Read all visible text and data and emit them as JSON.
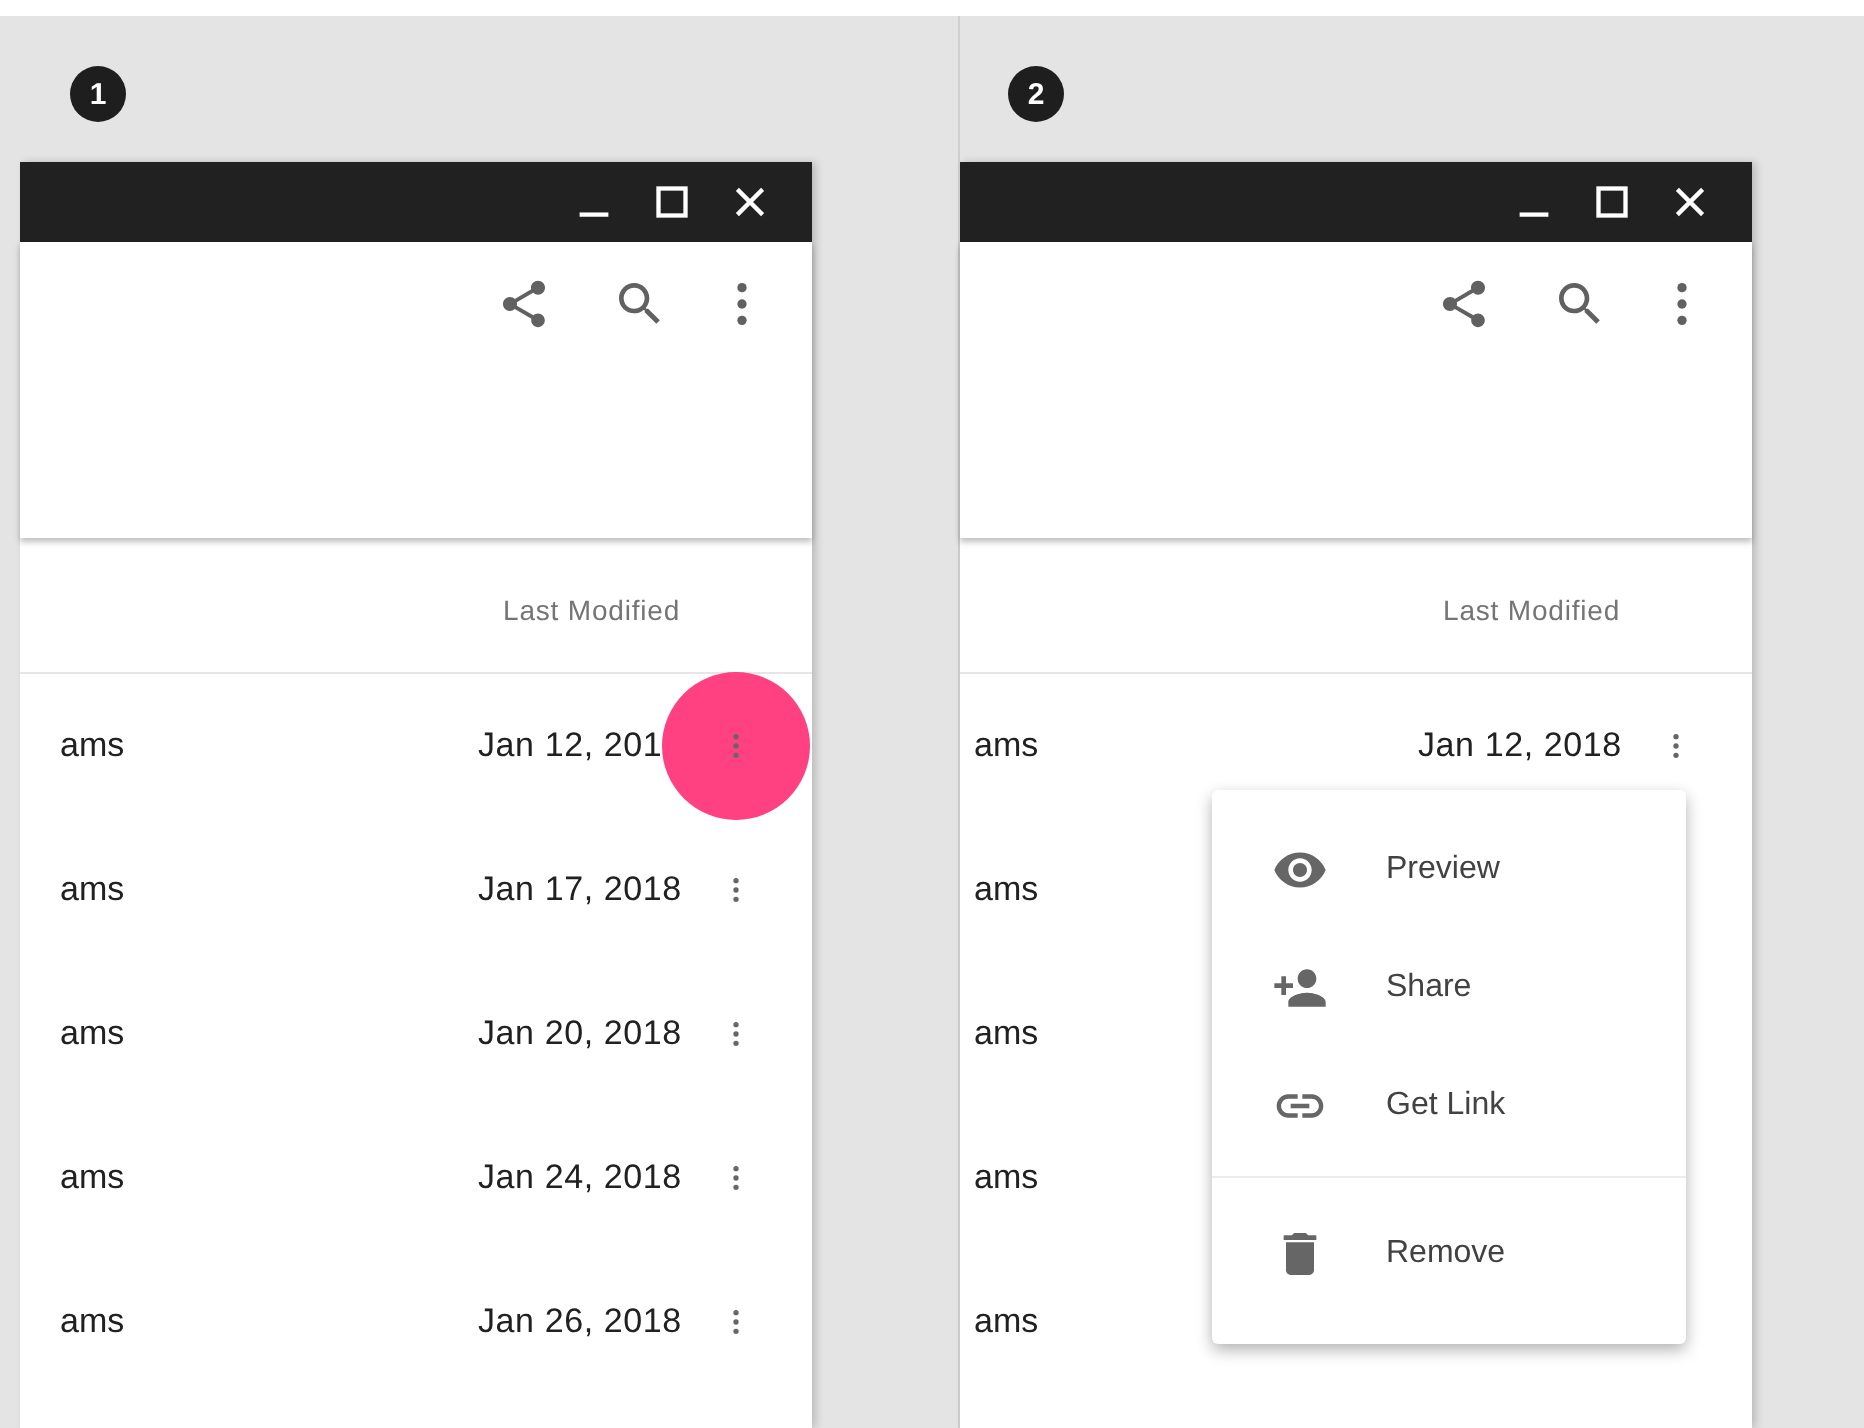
{
  "panels": [
    {
      "step": "1",
      "column_header": "Last Modified",
      "rows": [
        {
          "name": "ams",
          "date": "Jan 12, 201",
          "pressed": true
        },
        {
          "name": "ams",
          "date": "Jan 17, 2018",
          "pressed": false
        },
        {
          "name": "ams",
          "date": "Jan 20, 2018",
          "pressed": false
        },
        {
          "name": "ams",
          "date": "Jan 24, 2018",
          "pressed": false
        },
        {
          "name": "ams",
          "date": "Jan 26, 2018",
          "pressed": false
        }
      ]
    },
    {
      "step": "2",
      "column_header": "Last Modified",
      "rows": [
        {
          "name": "ams",
          "date": "Jan 12, 2018",
          "pressed": false
        },
        {
          "name": "ams",
          "pressed": false
        },
        {
          "name": "ams",
          "pressed": false
        },
        {
          "name": "ams",
          "pressed": false
        },
        {
          "name": "ams",
          "pressed": false
        }
      ],
      "menu": {
        "sections": [
          [
            {
              "kind": "eye",
              "label": "Preview"
            },
            {
              "kind": "person-add",
              "label": "Share"
            },
            {
              "kind": "link",
              "label": "Get Link"
            }
          ],
          [
            {
              "kind": "trash",
              "label": "Remove"
            }
          ]
        ]
      }
    }
  ]
}
